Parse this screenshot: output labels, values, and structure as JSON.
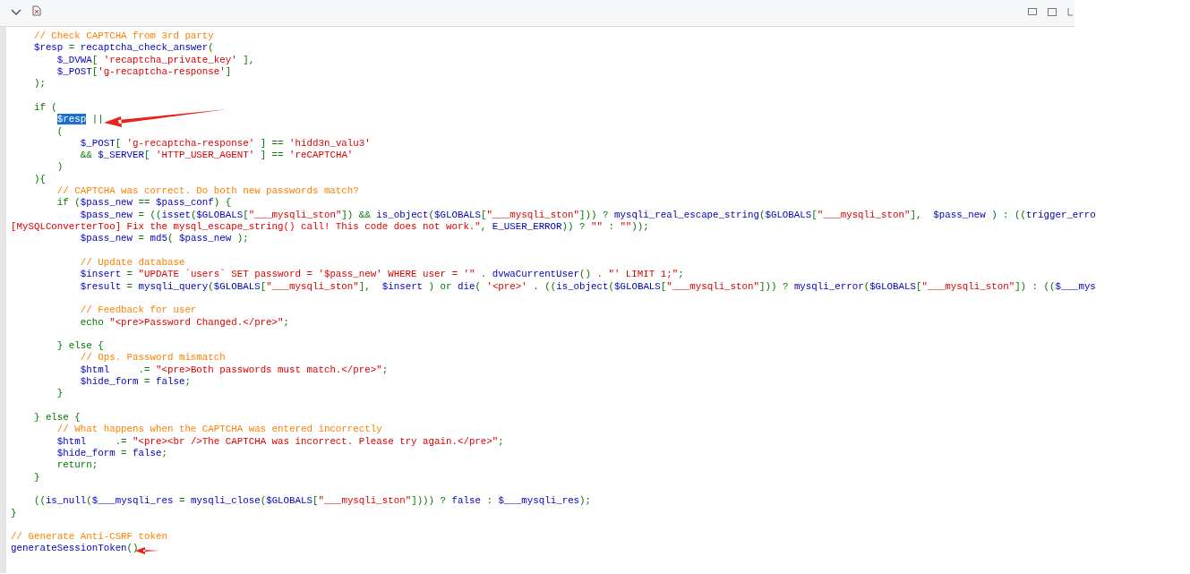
{
  "code_lines": [
    {
      "blank": false,
      "tokens": [
        {
          "kind": "comment",
          "text": "    // Check CAPTCHA from 3rd party"
        }
      ]
    },
    {
      "blank": false,
      "tokens": [
        {
          "kind": "plain",
          "text": "    $resp "
        },
        {
          "kind": "keyword",
          "text": "= "
        },
        {
          "kind": "plain",
          "text": "recaptcha_check_answer"
        },
        {
          "kind": "keyword",
          "text": "("
        }
      ]
    },
    {
      "blank": false,
      "tokens": [
        {
          "kind": "plain",
          "text": "        $_DVWA"
        },
        {
          "kind": "keyword",
          "text": "[ "
        },
        {
          "kind": "string",
          "text": "'recaptcha_private_key'"
        },
        {
          "kind": "keyword",
          "text": " ],"
        }
      ]
    },
    {
      "blank": false,
      "tokens": [
        {
          "kind": "plain",
          "text": "        $_POST"
        },
        {
          "kind": "keyword",
          "text": "["
        },
        {
          "kind": "string",
          "text": "'g-recaptcha-response'"
        },
        {
          "kind": "keyword",
          "text": "]"
        }
      ]
    },
    {
      "blank": false,
      "tokens": [
        {
          "kind": "keyword",
          "text": "    );"
        }
      ]
    },
    {
      "blank": true
    },
    {
      "blank": false,
      "tokens": [
        {
          "kind": "keyword",
          "text": "    if ("
        }
      ]
    },
    {
      "blank": false,
      "tokens": [
        {
          "kind": "selection",
          "text": "        $resp"
        },
        {
          "kind": "keyword",
          "text": " ||"
        }
      ]
    },
    {
      "blank": false,
      "tokens": [
        {
          "kind": "keyword",
          "text": "        ("
        }
      ]
    },
    {
      "blank": false,
      "tokens": [
        {
          "kind": "plain",
          "text": "            $_POST"
        },
        {
          "kind": "keyword",
          "text": "[ "
        },
        {
          "kind": "string",
          "text": "'g-recaptcha-response'"
        },
        {
          "kind": "keyword",
          "text": " ] == "
        },
        {
          "kind": "string",
          "text": "'hidd3n_valu3'"
        }
      ]
    },
    {
      "blank": false,
      "tokens": [
        {
          "kind": "keyword",
          "text": "            && "
        },
        {
          "kind": "plain",
          "text": "$_SERVER"
        },
        {
          "kind": "keyword",
          "text": "[ "
        },
        {
          "kind": "string",
          "text": "'HTTP_USER_AGENT'"
        },
        {
          "kind": "keyword",
          "text": " ] == "
        },
        {
          "kind": "string",
          "text": "'reCAPTCHA'"
        }
      ]
    },
    {
      "blank": false,
      "tokens": [
        {
          "kind": "keyword",
          "text": "        )"
        }
      ]
    },
    {
      "blank": false,
      "tokens": [
        {
          "kind": "keyword",
          "text": "    ){"
        }
      ]
    },
    {
      "blank": false,
      "tokens": [
        {
          "kind": "comment",
          "text": "        // CAPTCHA was correct. Do both new passwords match?"
        }
      ]
    },
    {
      "blank": false,
      "tokens": [
        {
          "kind": "keyword",
          "text": "        if ("
        },
        {
          "kind": "plain",
          "text": "$pass_new "
        },
        {
          "kind": "keyword",
          "text": "== "
        },
        {
          "kind": "plain",
          "text": "$pass_conf"
        },
        {
          "kind": "keyword",
          "text": ") {"
        }
      ]
    },
    {
      "blank": false,
      "tokens": [
        {
          "kind": "plain",
          "text": "            $pass_new "
        },
        {
          "kind": "keyword",
          "text": "= (("
        },
        {
          "kind": "plain",
          "text": "isset"
        },
        {
          "kind": "keyword",
          "text": "("
        },
        {
          "kind": "plain",
          "text": "$GLOBALS"
        },
        {
          "kind": "keyword",
          "text": "["
        },
        {
          "kind": "string",
          "text": "\"___mysqli_ston\""
        },
        {
          "kind": "keyword",
          "text": "]) && "
        },
        {
          "kind": "plain",
          "text": "is_object"
        },
        {
          "kind": "keyword",
          "text": "("
        },
        {
          "kind": "plain",
          "text": "$GLOBALS"
        },
        {
          "kind": "keyword",
          "text": "["
        },
        {
          "kind": "string",
          "text": "\"___mysqli_ston\""
        },
        {
          "kind": "keyword",
          "text": "])) ? "
        },
        {
          "kind": "plain",
          "text": "mysqli_real_escape_string"
        },
        {
          "kind": "keyword",
          "text": "("
        },
        {
          "kind": "plain",
          "text": "$GLOBALS"
        },
        {
          "kind": "keyword",
          "text": "["
        },
        {
          "kind": "string",
          "text": "\"___mysqli_ston\""
        },
        {
          "kind": "keyword",
          "text": "],  "
        },
        {
          "kind": "plain",
          "text": "$pass_new "
        },
        {
          "kind": "keyword",
          "text": ") : (("
        },
        {
          "kind": "plain",
          "text": "trigger_erro"
        }
      ]
    },
    {
      "blank": false,
      "tokens": [
        {
          "kind": "string",
          "text": "[MySQLConverterToo] Fix the mysql_escape_string() call! This code does not work.\""
        },
        {
          "kind": "keyword",
          "text": ", "
        },
        {
          "kind": "plain",
          "text": "E_USER_ERROR"
        },
        {
          "kind": "keyword",
          "text": ")) ? "
        },
        {
          "kind": "string",
          "text": "\"\""
        },
        {
          "kind": "keyword",
          "text": " : "
        },
        {
          "kind": "string",
          "text": "\"\""
        },
        {
          "kind": "keyword",
          "text": "));"
        }
      ]
    },
    {
      "blank": false,
      "tokens": [
        {
          "kind": "plain",
          "text": "            $pass_new "
        },
        {
          "kind": "keyword",
          "text": "= "
        },
        {
          "kind": "plain",
          "text": "md5"
        },
        {
          "kind": "keyword",
          "text": "( "
        },
        {
          "kind": "plain",
          "text": "$pass_new "
        },
        {
          "kind": "keyword",
          "text": ");"
        }
      ]
    },
    {
      "blank": true
    },
    {
      "blank": false,
      "tokens": [
        {
          "kind": "comment",
          "text": "            // Update database"
        }
      ]
    },
    {
      "blank": false,
      "tokens": [
        {
          "kind": "plain",
          "text": "            $insert "
        },
        {
          "kind": "keyword",
          "text": "= "
        },
        {
          "kind": "string",
          "text": "\"UPDATE `users` SET password = '$pass_new' WHERE user = '\""
        },
        {
          "kind": "keyword",
          "text": " . "
        },
        {
          "kind": "plain",
          "text": "dvwaCurrentUser"
        },
        {
          "kind": "keyword",
          "text": "() . "
        },
        {
          "kind": "string",
          "text": "\"' LIMIT 1;\""
        },
        {
          "kind": "keyword",
          "text": ";"
        }
      ]
    },
    {
      "blank": false,
      "tokens": [
        {
          "kind": "plain",
          "text": "            $result "
        },
        {
          "kind": "keyword",
          "text": "= "
        },
        {
          "kind": "plain",
          "text": "mysqli_query"
        },
        {
          "kind": "keyword",
          "text": "("
        },
        {
          "kind": "plain",
          "text": "$GLOBALS"
        },
        {
          "kind": "keyword",
          "text": "["
        },
        {
          "kind": "string",
          "text": "\"___mysqli_ston\""
        },
        {
          "kind": "keyword",
          "text": "],  "
        },
        {
          "kind": "plain",
          "text": "$insert "
        },
        {
          "kind": "keyword",
          "text": ") or "
        },
        {
          "kind": "plain",
          "text": "die"
        },
        {
          "kind": "keyword",
          "text": "( "
        },
        {
          "kind": "string",
          "text": "'<pre>'"
        },
        {
          "kind": "keyword",
          "text": " . (("
        },
        {
          "kind": "plain",
          "text": "is_object"
        },
        {
          "kind": "keyword",
          "text": "("
        },
        {
          "kind": "plain",
          "text": "$GLOBALS"
        },
        {
          "kind": "keyword",
          "text": "["
        },
        {
          "kind": "string",
          "text": "\"___mysqli_ston\""
        },
        {
          "kind": "keyword",
          "text": "])) ? "
        },
        {
          "kind": "plain",
          "text": "mysqli_error"
        },
        {
          "kind": "keyword",
          "text": "("
        },
        {
          "kind": "plain",
          "text": "$GLOBALS"
        },
        {
          "kind": "keyword",
          "text": "["
        },
        {
          "kind": "string",
          "text": "\"___mysqli_ston\""
        },
        {
          "kind": "keyword",
          "text": "]) : (("
        },
        {
          "kind": "plain",
          "text": "$___mys"
        }
      ]
    },
    {
      "blank": true
    },
    {
      "blank": false,
      "tokens": [
        {
          "kind": "comment",
          "text": "            // Feedback for user"
        }
      ]
    },
    {
      "blank": false,
      "tokens": [
        {
          "kind": "keyword",
          "text": "            echo "
        },
        {
          "kind": "string",
          "text": "\"<pre>Password Changed.</pre>\""
        },
        {
          "kind": "keyword",
          "text": ";"
        }
      ]
    },
    {
      "blank": true
    },
    {
      "blank": false,
      "tokens": [
        {
          "kind": "keyword",
          "text": "        } else {"
        }
      ]
    },
    {
      "blank": false,
      "tokens": [
        {
          "kind": "comment",
          "text": "            // Ops. Password mismatch"
        }
      ]
    },
    {
      "blank": false,
      "tokens": [
        {
          "kind": "plain",
          "text": "            $html     "
        },
        {
          "kind": "keyword",
          "text": ".= "
        },
        {
          "kind": "string",
          "text": "\"<pre>Both passwords must match.</pre>\""
        },
        {
          "kind": "keyword",
          "text": ";"
        }
      ]
    },
    {
      "blank": false,
      "tokens": [
        {
          "kind": "plain",
          "text": "            $hide_form "
        },
        {
          "kind": "keyword",
          "text": "= "
        },
        {
          "kind": "plain",
          "text": "false"
        },
        {
          "kind": "keyword",
          "text": ";"
        }
      ]
    },
    {
      "blank": false,
      "tokens": [
        {
          "kind": "keyword",
          "text": "        }"
        }
      ]
    },
    {
      "blank": true
    },
    {
      "blank": false,
      "tokens": [
        {
          "kind": "keyword",
          "text": "    } else {"
        }
      ]
    },
    {
      "blank": false,
      "tokens": [
        {
          "kind": "comment",
          "text": "        // What happens when the CAPTCHA was entered incorrectly"
        }
      ]
    },
    {
      "blank": false,
      "tokens": [
        {
          "kind": "plain",
          "text": "        $html     "
        },
        {
          "kind": "keyword",
          "text": ".= "
        },
        {
          "kind": "string",
          "text": "\"<pre><br />The CAPTCHA was incorrect. Please try again.</pre>\""
        },
        {
          "kind": "keyword",
          "text": ";"
        }
      ]
    },
    {
      "blank": false,
      "tokens": [
        {
          "kind": "plain",
          "text": "        $hide_form "
        },
        {
          "kind": "keyword",
          "text": "= "
        },
        {
          "kind": "plain",
          "text": "false"
        },
        {
          "kind": "keyword",
          "text": ";"
        }
      ]
    },
    {
      "blank": false,
      "tokens": [
        {
          "kind": "keyword",
          "text": "        return;"
        }
      ]
    },
    {
      "blank": false,
      "tokens": [
        {
          "kind": "keyword",
          "text": "    }"
        }
      ]
    },
    {
      "blank": true
    },
    {
      "blank": false,
      "tokens": [
        {
          "kind": "keyword",
          "text": "    (("
        },
        {
          "kind": "plain",
          "text": "is_null"
        },
        {
          "kind": "keyword",
          "text": "("
        },
        {
          "kind": "plain",
          "text": "$___mysqli_res "
        },
        {
          "kind": "keyword",
          "text": "= "
        },
        {
          "kind": "plain",
          "text": "mysqli_close"
        },
        {
          "kind": "keyword",
          "text": "("
        },
        {
          "kind": "plain",
          "text": "$GLOBALS"
        },
        {
          "kind": "keyword",
          "text": "["
        },
        {
          "kind": "string",
          "text": "\"___mysqli_ston\""
        },
        {
          "kind": "keyword",
          "text": "]))) ? "
        },
        {
          "kind": "plain",
          "text": "false "
        },
        {
          "kind": "keyword",
          "text": ": "
        },
        {
          "kind": "plain",
          "text": "$___mysqli_res"
        },
        {
          "kind": "keyword",
          "text": ");"
        }
      ]
    },
    {
      "blank": false,
      "tokens": [
        {
          "kind": "keyword",
          "text": "}"
        }
      ]
    },
    {
      "blank": true
    },
    {
      "blank": false,
      "tokens": [
        {
          "kind": "comment",
          "text": "// Generate Anti-CSRF token"
        }
      ]
    },
    {
      "blank": false,
      "tokens": [
        {
          "kind": "plain",
          "text": "generateSessionToken"
        },
        {
          "kind": "keyword",
          "text": "()"
        }
      ]
    }
  ]
}
